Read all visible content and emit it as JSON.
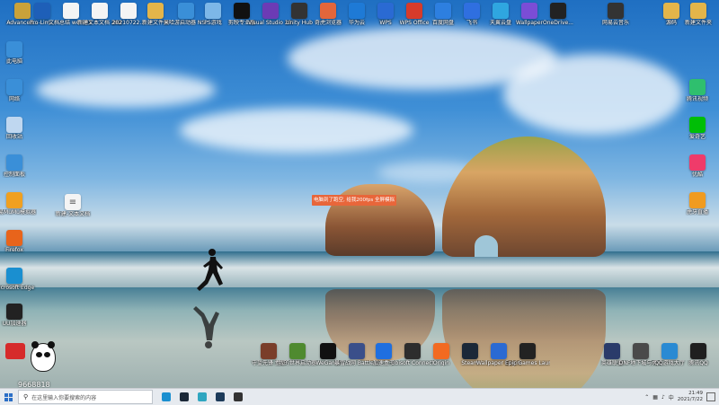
{
  "desktop": {
    "notice_text": "电脑到了跑空, 给我200fps 全屏模拟",
    "top_row": [
      {
        "label": "Advanced...",
        "icon": "folder-icon",
        "color": "#c9a23a"
      },
      {
        "label": "Pro-Lim...",
        "icon": "gear-icon",
        "color": "#1e5fb8"
      },
      {
        "label": "文档总结 work01 c...",
        "icon": "doc-icon",
        "color": "#f4f4f4"
      },
      {
        "label": "新建文本文档 2021...",
        "icon": "doc-icon",
        "color": "#f4f4f4"
      },
      {
        "label": "20210722...",
        "icon": "doc-icon",
        "color": "#f4f4f4"
      },
      {
        "label": "新建文件夹",
        "icon": "folder-icon",
        "color": "#e3b54a"
      },
      {
        "label": "米哈游启动器 NS...",
        "icon": "game-icon",
        "color": "#3a8fd8"
      },
      {
        "label": "PS游戏",
        "icon": "game-icon",
        "color": "#7db7e8"
      },
      {
        "label": "剪映专业版",
        "icon": "capcut-icon",
        "color": "#111"
      },
      {
        "label": "Visual Studio 2019",
        "icon": "vs-icon",
        "color": "#6c3bb5"
      },
      {
        "label": "Unity Hub",
        "icon": "unity-icon",
        "color": "#333"
      },
      {
        "label": "奇虎浏览器",
        "icon": "browser-icon",
        "color": "#e3663b"
      },
      {
        "label": "华为云",
        "icon": "cloud-icon",
        "color": "#1e7ad6"
      },
      {
        "label": "WPS",
        "icon": "wps-icon",
        "color": "#2a6ad3"
      },
      {
        "label": "WPS Office",
        "icon": "wps-icon",
        "color": "#d63b2b"
      },
      {
        "label": "百度网盘",
        "icon": "cloud-icon",
        "color": "#2d7fe0"
      },
      {
        "label": "飞书",
        "icon": "plane-icon",
        "color": "#2f6fe0"
      },
      {
        "label": "天翼云盘",
        "icon": "cloud-icon",
        "color": "#2fa6e0"
      },
      {
        "label": "Wallpaper",
        "icon": "wallpaper-icon",
        "color": "#7b4dd6"
      },
      {
        "label": "OneDrive...",
        "icon": "app-icon",
        "color": "#222"
      },
      {
        "label": "网易云音乐",
        "icon": "music-icon",
        "color": "#333"
      },
      {
        "label": "源码",
        "icon": "folder-icon",
        "color": "#e3b54a"
      },
      {
        "label": "新建文件夹",
        "icon": "folder-icon",
        "color": "#e3b54a"
      }
    ],
    "left_column": [
      {
        "label": "此电脑",
        "icon": "pc-icon",
        "color": "#3a8fd8"
      },
      {
        "label": "网络",
        "icon": "network-icon",
        "color": "#3a8fd8"
      },
      {
        "label": "回收站",
        "icon": "recycle-icon",
        "color": "#bfd7f0"
      },
      {
        "label": "控制面板",
        "icon": "panel-icon",
        "color": "#3a8fd8"
      },
      {
        "label": "网易MuMu模拟器",
        "icon": "emulator-icon",
        "color": "#f0a020"
      },
      {
        "label": "Firefox",
        "icon": "firefox-icon",
        "color": "#e8641b"
      },
      {
        "label": "Microsoft Edge",
        "icon": "edge-icon",
        "color": "#1a8fd0"
      },
      {
        "label": "UU加速器",
        "icon": "accelerator-icon",
        "color": "#222"
      }
    ],
    "middle_icon": {
      "label": "新建-文本文档",
      "icon": "doc-icon",
      "color": "#f4f4f4"
    },
    "right_column": [
      {
        "label": "腾讯视频",
        "icon": "video-icon",
        "color": "#2fbf6e"
      },
      {
        "label": "爱奇艺",
        "icon": "video-icon",
        "color": "#00be06"
      },
      {
        "label": "优酷",
        "icon": "video-icon",
        "color": "#ef3b6a"
      },
      {
        "label": "虎牙直播",
        "icon": "live-icon",
        "color": "#f09b20"
      }
    ],
    "bottom_row": [
      {
        "label": "守望先锋 盒子",
        "icon": "game-icon",
        "color": "#7a3e2a"
      },
      {
        "label": "我的世界启动器",
        "icon": "minecraft-icon",
        "color": "#4f8a2f"
      },
      {
        "label": "WeGame",
        "icon": "wegame-icon",
        "color": "#111"
      },
      {
        "label": "暴雪战网 Battle.net",
        "icon": "battlenet-icon",
        "color": "#3a4f8a"
      },
      {
        "label": "加速盒子",
        "icon": "boost-icon",
        "color": "#1f6fe0"
      },
      {
        "label": "Ubisoft Connect",
        "icon": "ubisoft-icon",
        "color": "#2d2d2d"
      },
      {
        "label": "Origin",
        "icon": "origin-icon",
        "color": "#f26a21"
      },
      {
        "label": "Steam",
        "icon": "steam-icon",
        "color": "#1b2838"
      },
      {
        "label": "Wallpaper Engine",
        "icon": "wallpaper-icon",
        "color": "#2a6ad3"
      },
      {
        "label": "Epic Games Launcher",
        "icon": "epic-icon",
        "color": "#222"
      }
    ],
    "bottom_right": [
      {
        "label": "英雄联盟",
        "icon": "lol-icon",
        "color": "#2a3b6a"
      },
      {
        "label": "DNF地下城与勇士",
        "icon": "dnf-icon",
        "color": "#4a4a4a"
      },
      {
        "label": "QQ游戏大厅",
        "icon": "qq-game-icon",
        "color": "#2a8ad3"
      },
      {
        "label": "腾讯QQ",
        "icon": "qq-icon",
        "color": "#1f1f1f"
      }
    ],
    "watermark_id": "9668818"
  },
  "taskbar": {
    "search_placeholder": "在这里输入你要搜索的内容",
    "pinned": [
      {
        "name": "edge-taskbar-icon",
        "color": "#1a8fd0"
      },
      {
        "name": "steam-taskbar-icon",
        "color": "#1b2838"
      },
      {
        "name": "app-taskbar-icon",
        "color": "#2fa6c0"
      },
      {
        "name": "terminal-taskbar-icon",
        "color": "#1d3b5a"
      },
      {
        "name": "unity-taskbar-icon",
        "color": "#333"
      }
    ],
    "clock_time": "21:49",
    "clock_date": "2021/7/22"
  }
}
